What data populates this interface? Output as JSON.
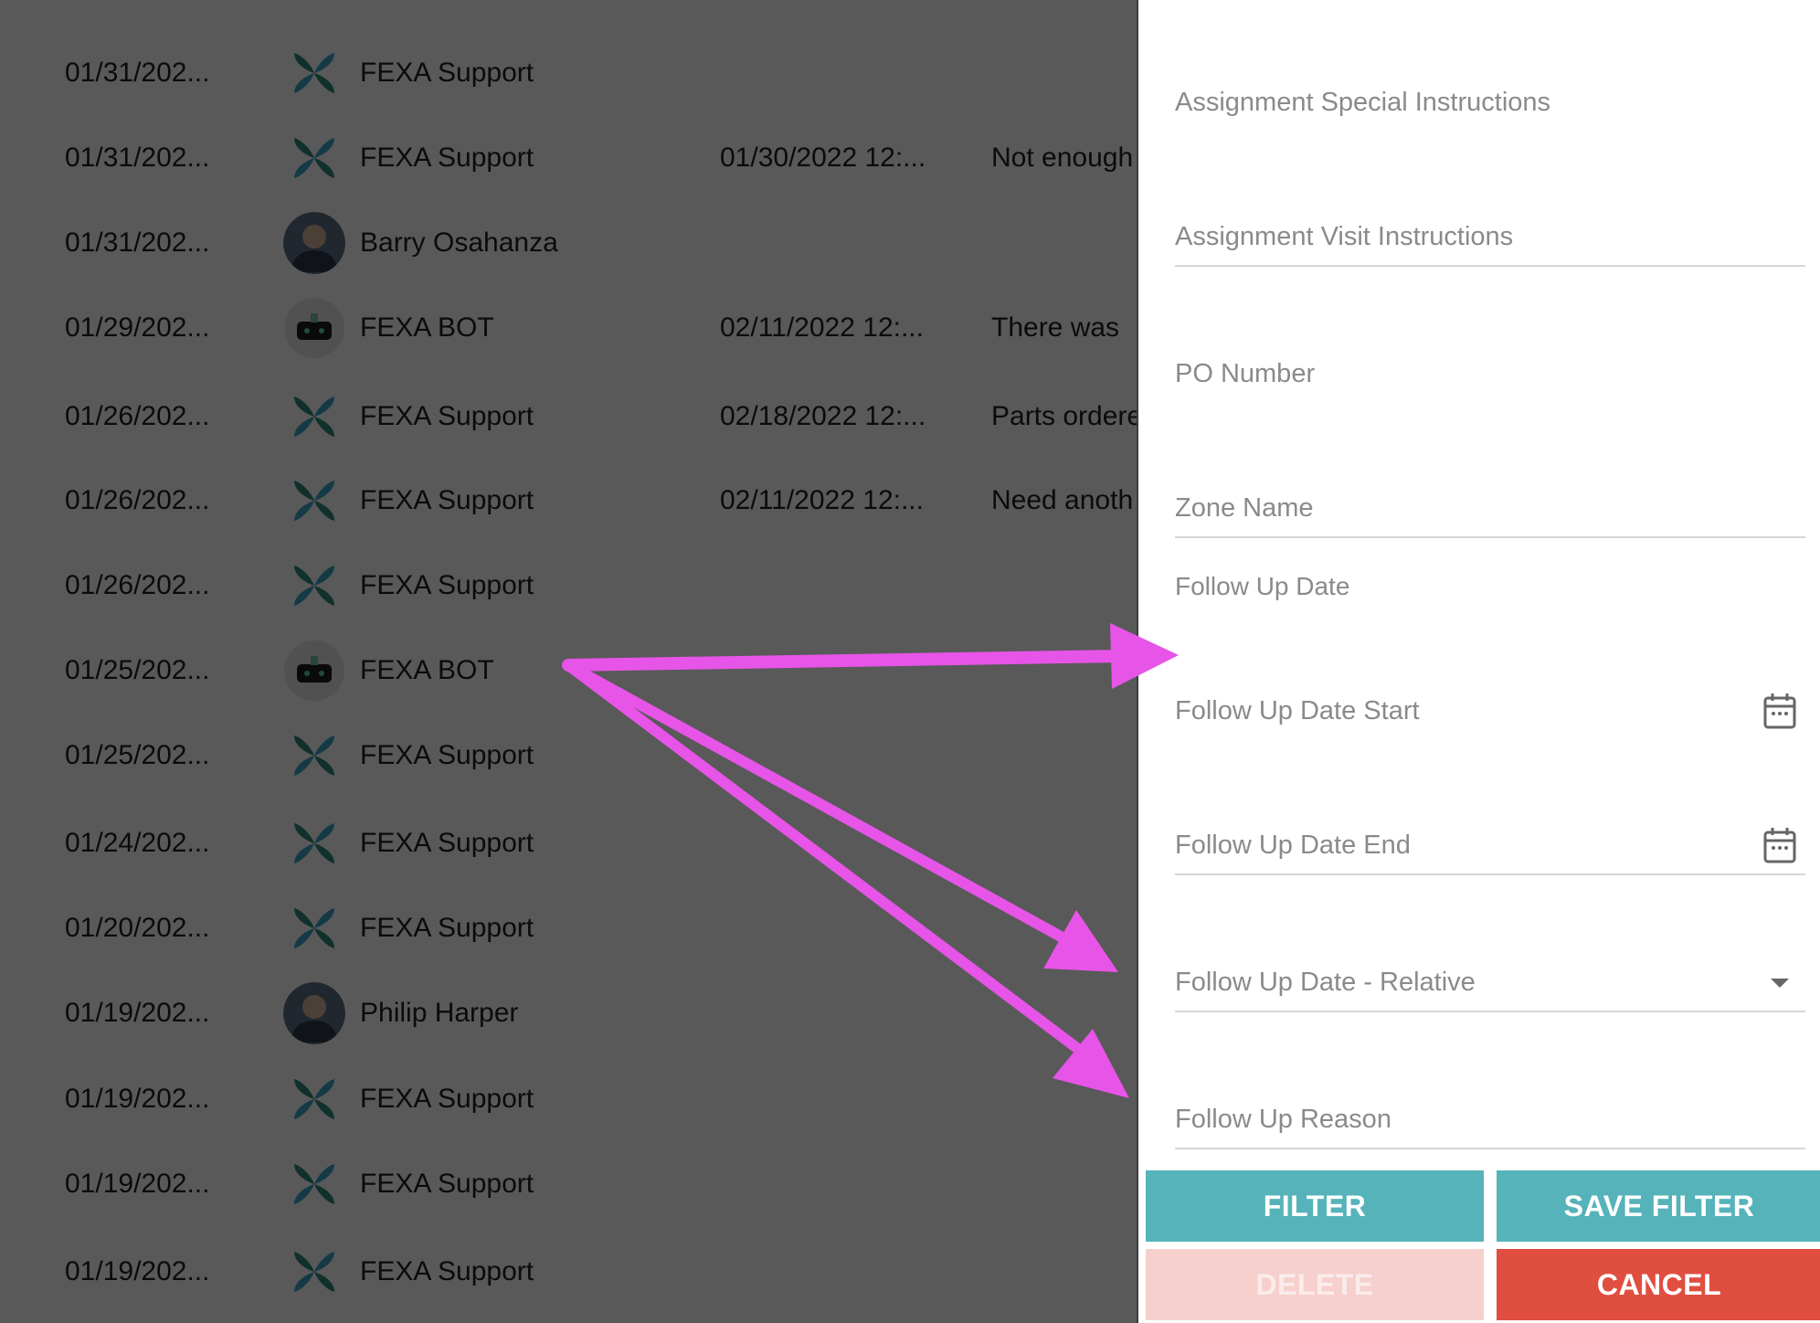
{
  "background_rows": [
    {
      "date": "01/31/202...",
      "avatar": "fexa-logo-icon",
      "name": "FEXA Support",
      "followup_date": "",
      "reason": ""
    },
    {
      "date": "01/31/202...",
      "avatar": "fexa-logo-icon",
      "name": "FEXA Support",
      "followup_date": "01/30/2022 12:...",
      "reason": "Not enough"
    },
    {
      "date": "01/31/202...",
      "avatar": "person-photo-icon",
      "name": "Barry Osahanza",
      "followup_date": "",
      "reason": ""
    },
    {
      "date": "01/29/202...",
      "avatar": "bot-icon",
      "name": "FEXA BOT",
      "followup_date": "02/11/2022 12:...",
      "reason": "There was"
    },
    {
      "date": "01/26/202...",
      "avatar": "fexa-logo-icon",
      "name": "FEXA Support",
      "followup_date": "02/18/2022 12:...",
      "reason": "Parts ordere"
    },
    {
      "date": "01/26/202...",
      "avatar": "fexa-logo-icon",
      "name": "FEXA Support",
      "followup_date": "02/11/2022 12:...",
      "reason": "Need anoth"
    },
    {
      "date": "01/26/202...",
      "avatar": "fexa-logo-icon",
      "name": "FEXA Support",
      "followup_date": "",
      "reason": ""
    },
    {
      "date": "01/25/202...",
      "avatar": "bot-icon",
      "name": "FEXA BOT",
      "followup_date": "",
      "reason": ""
    },
    {
      "date": "01/25/202...",
      "avatar": "fexa-logo-icon",
      "name": "FEXA Support",
      "followup_date": "",
      "reason": ""
    },
    {
      "date": "01/24/202...",
      "avatar": "fexa-logo-icon",
      "name": "FEXA Support",
      "followup_date": "",
      "reason": ""
    },
    {
      "date": "01/20/202...",
      "avatar": "fexa-logo-icon",
      "name": "FEXA Support",
      "followup_date": "",
      "reason": ""
    },
    {
      "date": "01/19/202...",
      "avatar": "person-photo-icon",
      "name": "Philip Harper",
      "followup_date": "",
      "reason": ""
    },
    {
      "date": "01/19/202...",
      "avatar": "fexa-logo-icon",
      "name": "FEXA Support",
      "followup_date": "",
      "reason": ""
    },
    {
      "date": "01/19/202...",
      "avatar": "fexa-logo-icon",
      "name": "FEXA Support",
      "followup_date": "",
      "reason": ""
    },
    {
      "date": "01/19/202...",
      "avatar": "fexa-logo-icon",
      "name": "FEXA Support",
      "followup_date": "",
      "reason": ""
    }
  ],
  "filter_panel": {
    "assignment_special_instructions": "Assignment Special Instructions",
    "assignment_visit_instructions": "Assignment Visit Instructions",
    "po_number": "PO Number",
    "zone_name": "Zone Name",
    "follow_up_date_section": "Follow Up Date",
    "follow_up_date_start": "Follow Up Date Start",
    "follow_up_date_end": "Follow Up Date End",
    "follow_up_date_relative": "Follow Up Date - Relative",
    "follow_up_reason": "Follow Up Reason",
    "buttons": {
      "filter": "FILTER",
      "save_filter": "SAVE FILTER",
      "delete": "DELETE",
      "cancel": "CANCEL"
    }
  },
  "colors": {
    "teal_button": "#56b3ba",
    "cancel_button": "#e04e40",
    "delete_button_disabled": "#f5d0cc",
    "annotation_arrow": "#e754e8",
    "fexa_logo_green": "#2f8a7c",
    "fexa_logo_teal": "#3aa7c9"
  }
}
